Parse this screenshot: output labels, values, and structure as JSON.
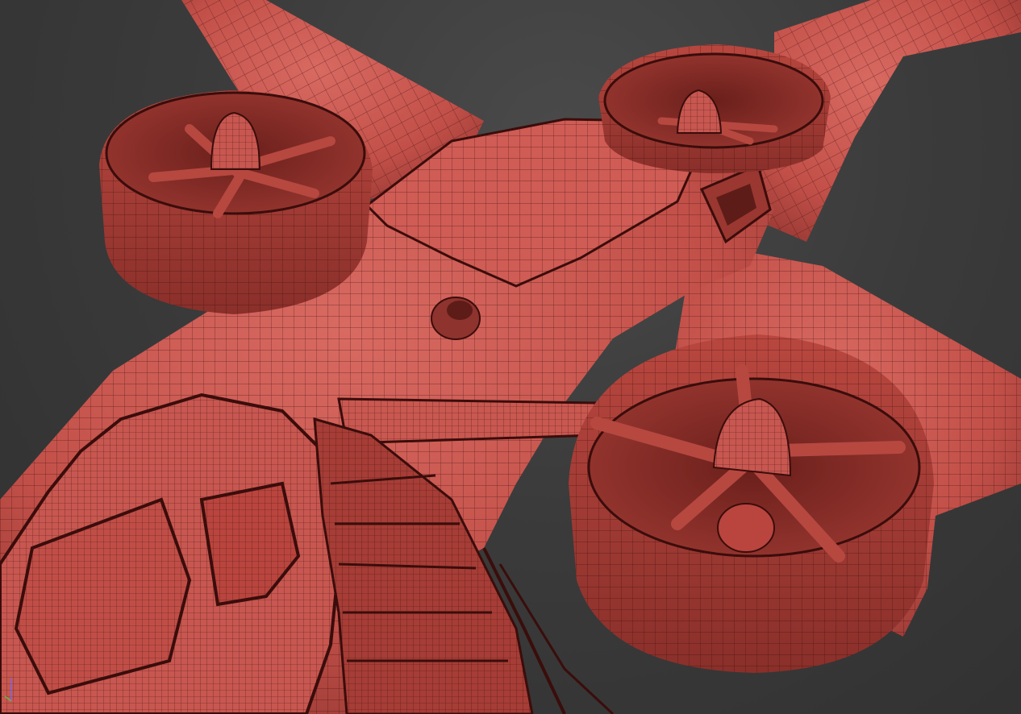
{
  "viewport": {
    "display_mode": "wireframe-on-shaded",
    "model_color": "#c9554e",
    "model_shadow_color": "#7a2a26",
    "wire_color": "#3a0d0b",
    "background_color": "#3a3a3a",
    "gizmo_icon": "axis-gizmo-icon"
  },
  "model": {
    "parts": [
      "fuselage",
      "cockpit-canopy",
      "dorsal-hatch",
      "left-wing",
      "right-wing",
      "tail-boom",
      "ducted-fan-front-left",
      "ducted-fan-front-right",
      "ducted-fan-rear-right",
      "boarding-stairs",
      "side-door"
    ]
  }
}
